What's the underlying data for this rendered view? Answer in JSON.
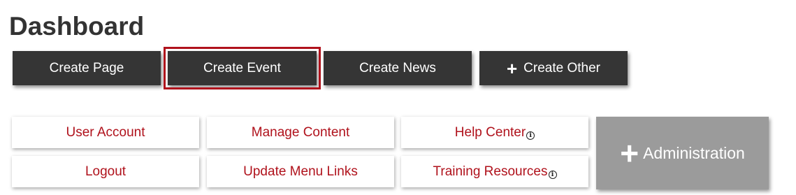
{
  "header": {
    "title": "Dashboard"
  },
  "create_buttons": [
    {
      "label": "Create Page"
    },
    {
      "label": "Create Event"
    },
    {
      "label": "Create News"
    },
    {
      "label": "Create Other"
    }
  ],
  "links": {
    "user_account": "User Account",
    "logout": "Logout",
    "manage_content": "Manage Content",
    "update_menu_links": "Update Menu Links",
    "help_center": "Help Center",
    "training_resources": "Training Resources"
  },
  "admin": {
    "label": "Administration"
  },
  "icons": {
    "plus": "+",
    "info": "i"
  },
  "colors": {
    "dark_button": "#353535",
    "accent_red": "#b0121c",
    "admin_gray": "#9b9b9b",
    "title_text": "#333333"
  }
}
